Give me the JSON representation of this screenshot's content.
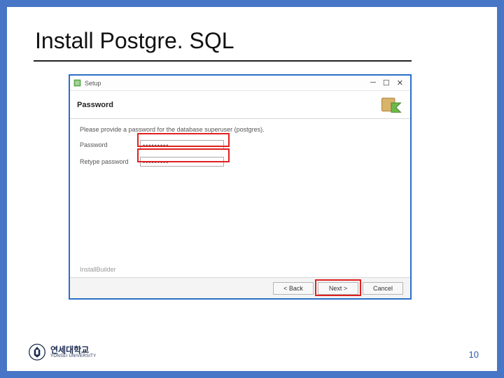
{
  "slide": {
    "title": "Install Postgre. SQL",
    "page_number": "10"
  },
  "university": {
    "name_kr": "연세대학교",
    "name_en": "YONSEI UNIVERSITY"
  },
  "installer": {
    "window_title": "Setup",
    "header_title": "Password",
    "instruction": "Please provide a password for the database superuser (postgres).",
    "password_label": "Password",
    "retype_label": "Retype password",
    "password_value": "•••••••••",
    "retype_value": "•••••••••",
    "builder": "InstallBuilder",
    "buttons": {
      "back": "< Back",
      "next": "Next >",
      "cancel": "Cancel"
    }
  }
}
